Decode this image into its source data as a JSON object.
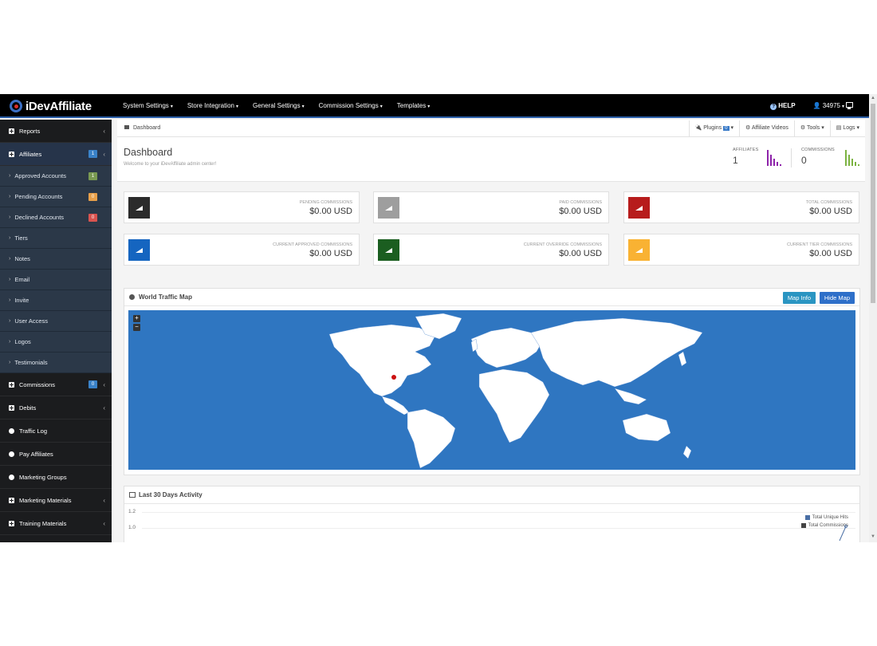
{
  "app": {
    "logo_text": "iDevAffiliate"
  },
  "topnav": {
    "items": [
      {
        "label": "System Settings"
      },
      {
        "label": "Store Integration"
      },
      {
        "label": "General Settings"
      },
      {
        "label": "Commission Settings"
      },
      {
        "label": "Templates"
      }
    ],
    "help_label": "HELP",
    "user_label": "34975"
  },
  "sidebar": {
    "items": [
      {
        "label": "Reports"
      },
      {
        "label": "Affiliates",
        "badge": "1"
      },
      {
        "label": "Approved Accounts",
        "badge": "1"
      },
      {
        "label": "Pending Accounts",
        "badge": "0"
      },
      {
        "label": "Declined Accounts",
        "badge": "0"
      },
      {
        "label": "Tiers"
      },
      {
        "label": "Notes"
      },
      {
        "label": "Email"
      },
      {
        "label": "Invite"
      },
      {
        "label": "User Access"
      },
      {
        "label": "Logos"
      },
      {
        "label": "Testimonials"
      },
      {
        "label": "Commissions",
        "badge": "0"
      },
      {
        "label": "Debits"
      },
      {
        "label": "Traffic Log"
      },
      {
        "label": "Pay Affiliates"
      },
      {
        "label": "Marketing Groups"
      },
      {
        "label": "Marketing Materials"
      },
      {
        "label": "Training Materials"
      }
    ],
    "colors": {
      "blue": "#3a82c8",
      "green": "#7a9a52",
      "orange": "#e8a04a",
      "red": "#d9534f"
    }
  },
  "breadcrumb": {
    "label": "Dashboard"
  },
  "toolbar": {
    "plugins_label": "Plugins",
    "plugins_badge": "0",
    "videos_label": "Affiliate Videos",
    "tools_label": "Tools",
    "logs_label": "Logs"
  },
  "header": {
    "title": "Dashboard",
    "subtitle": "Welcome to your iDevAffiliate admin center!",
    "affiliates_label": "AFFILIATES",
    "affiliates_value": "1",
    "commissions_label": "COMMISSIONS",
    "commissions_value": "0"
  },
  "cards": [
    {
      "label": "PENDING COMMISSIONS",
      "value": "$0.00 USD",
      "color": "#2b2b2b"
    },
    {
      "label": "PAID COMMISSIONS",
      "value": "$0.00 USD",
      "color": "#9e9e9e"
    },
    {
      "label": "TOTAL COMMISSIONS",
      "value": "$0.00 USD",
      "color": "#b71c1c"
    },
    {
      "label": "CURRENT APPROVED COMMISSIONS",
      "value": "$0.00 USD",
      "color": "#1565c0"
    },
    {
      "label": "CURRENT OVERRIDE COMMISSIONS",
      "value": "$0.00 USD",
      "color": "#1b5e20"
    },
    {
      "label": "CURRENT TIER COMMISSIONS",
      "value": "$0.00 USD",
      "color": "#f9b233"
    }
  ],
  "map_panel": {
    "title": "World Traffic Map",
    "map_info_label": "Map Info",
    "hide_map_label": "Hide Map",
    "zoom_in": "+",
    "zoom_out": "−",
    "ocean_color": "#2f76c1"
  },
  "activity_panel": {
    "title": "Last 30 Days Activity",
    "y_ticks": [
      "1.2",
      "1.0"
    ],
    "legend": [
      {
        "label": "Total Unique Hits",
        "color": "#4a6fa5"
      },
      {
        "label": "Total Commissions",
        "color": "#444444"
      }
    ]
  }
}
